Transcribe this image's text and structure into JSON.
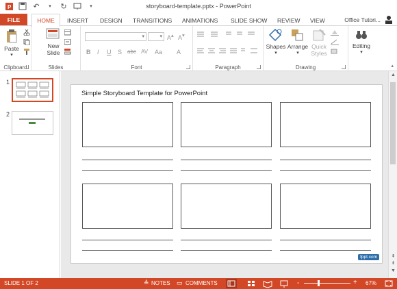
{
  "window": {
    "title": "storyboard-template.pptx - PowerPoint",
    "account": "Office Tutori..."
  },
  "tabs": [
    "FILE",
    "HOME",
    "INSERT",
    "DESIGN",
    "TRANSITIONS",
    "ANIMATIONS",
    "SLIDE SHOW",
    "REVIEW",
    "VIEW"
  ],
  "ribbon": {
    "paste": "Paste",
    "new_slide_1": "New",
    "new_slide_2": "Slide",
    "shapes": "Shapes",
    "arrange": "Arrange",
    "quick_styles_1": "Quick",
    "quick_styles_2": "Styles",
    "editing": "Editing",
    "groups": {
      "clipboard": "Clipboard",
      "slides": "Slides",
      "font": "Font",
      "paragraph": "Paragraph",
      "drawing": "Drawing"
    },
    "font_buttons": [
      "B",
      "I",
      "U",
      "S",
      "abc",
      "AV",
      "Aa",
      "A"
    ]
  },
  "thumbnails": [
    {
      "number": "1",
      "selected": true
    },
    {
      "number": "2",
      "selected": false
    }
  ],
  "slide": {
    "title": "Simple Storyboard Template for PowerPoint",
    "watermark": "fppt.com"
  },
  "status": {
    "slide_info": "SLIDE 1 OF 2",
    "notes": "NOTES",
    "comments": "COMMENTS",
    "zoom": "67%",
    "zoom_minus": "-",
    "zoom_plus": "+"
  },
  "colors": {
    "accent": "#d24726"
  }
}
